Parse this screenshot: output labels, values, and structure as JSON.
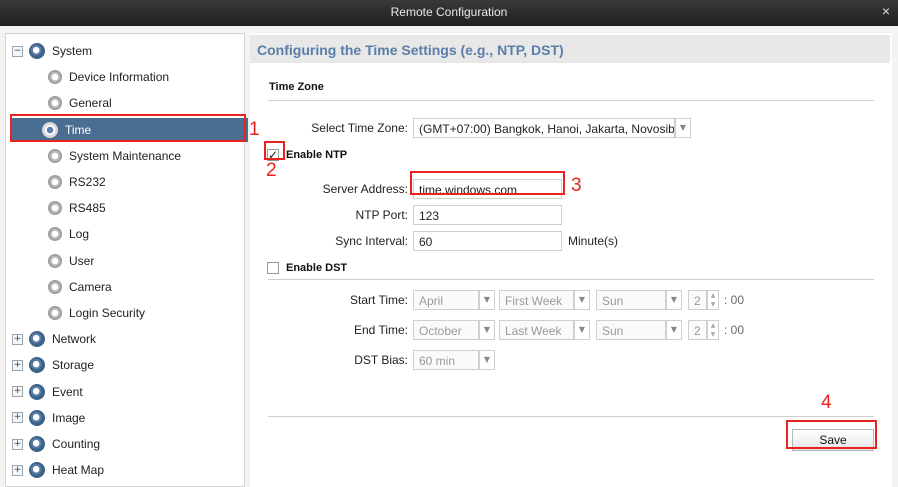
{
  "window": {
    "title": "Remote Configuration",
    "close_glyph": "×"
  },
  "sidebar": {
    "items": [
      {
        "label": "System",
        "level": "parent",
        "expanded": true,
        "expander": "−"
      },
      {
        "label": "Device Information",
        "level": "child"
      },
      {
        "label": "General",
        "level": "child"
      },
      {
        "label": "Time",
        "level": "child",
        "selected": true
      },
      {
        "label": "System Maintenance",
        "level": "child"
      },
      {
        "label": "RS232",
        "level": "child"
      },
      {
        "label": "RS485",
        "level": "child"
      },
      {
        "label": "Log",
        "level": "child"
      },
      {
        "label": "User",
        "level": "child"
      },
      {
        "label": "Camera",
        "level": "child"
      },
      {
        "label": "Login Security",
        "level": "child"
      },
      {
        "label": "Network",
        "level": "parent",
        "expander": "+"
      },
      {
        "label": "Storage",
        "level": "parent",
        "expander": "+"
      },
      {
        "label": "Event",
        "level": "parent",
        "expander": "+"
      },
      {
        "label": "Image",
        "level": "parent",
        "expander": "+"
      },
      {
        "label": "Counting",
        "level": "parent",
        "expander": "+"
      },
      {
        "label": "Heat Map",
        "level": "parent",
        "expander": "+"
      }
    ]
  },
  "main": {
    "heading": "Configuring the Time Settings (e.g., NTP, DST)",
    "time_zone": {
      "section_title": "Time Zone",
      "select_label": "Select Time Zone:",
      "select_value": "(GMT+07:00) Bangkok, Hanoi, Jakarta, Novosib..."
    },
    "ntp": {
      "checkbox_label": "Enable NTP",
      "checked": true,
      "check_glyph": "✓",
      "server_label": "Server Address:",
      "server_value": "time.windows.com",
      "port_label": "NTP Port:",
      "port_value": "123",
      "interval_label": "Sync Interval:",
      "interval_value": "60",
      "interval_unit": "Minute(s)"
    },
    "dst": {
      "checkbox_label": "Enable DST",
      "checked": false,
      "start_label": "Start Time:",
      "start_month": "April",
      "start_week": "First Week",
      "start_day": "Sun",
      "start_hour": "2",
      "start_min": ": 00",
      "end_label": "End Time:",
      "end_month": "October",
      "end_week": "Last Week",
      "end_day": "Sun",
      "end_hour": "2",
      "end_min": ": 00",
      "bias_label": "DST Bias:",
      "bias_value": "60 min"
    },
    "save_label": "Save"
  },
  "annotations": {
    "n1": "1",
    "n2": "2",
    "n3": "3",
    "n4": "4",
    "color": "#e8221c"
  },
  "glyphs": {
    "dropdown": "▼",
    "spin_up": "▲",
    "spin_down": "▼"
  }
}
